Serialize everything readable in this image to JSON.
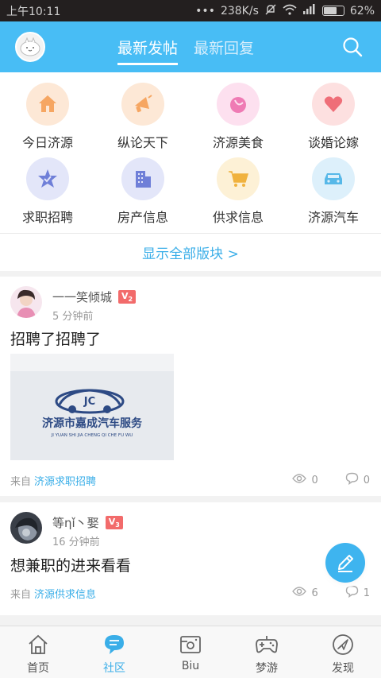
{
  "status_bar": {
    "time": "上午10:11",
    "speed": "238K/s",
    "battery": "62%"
  },
  "header": {
    "tabs": [
      {
        "label": "最新发帖",
        "active": true
      },
      {
        "label": "最新回复",
        "active": false
      }
    ],
    "accent": "#48bdf5"
  },
  "categories": [
    {
      "label": "今日济源",
      "icon": "house-icon",
      "bg": "#fde8d6",
      "color": "#f6a662"
    },
    {
      "label": "纵论天下",
      "icon": "megaphone-icon",
      "bg": "#fde8d6",
      "color": "#f6a662"
    },
    {
      "label": "济源美食",
      "icon": "food-icon",
      "bg": "#fde0ef",
      "color": "#ef7bb4"
    },
    {
      "label": "谈婚论嫁",
      "icon": "heart-icon",
      "bg": "#fde0e0",
      "color": "#ef6e78"
    },
    {
      "label": "求职招聘",
      "icon": "star-badge-icon",
      "bg": "#e3e6f9",
      "color": "#6f7fd8"
    },
    {
      "label": "房产信息",
      "icon": "building-icon",
      "bg": "#e3e6f9",
      "color": "#6f7fd8"
    },
    {
      "label": "供求信息",
      "icon": "cart-icon",
      "bg": "#fdf1d6",
      "color": "#f0b23e"
    },
    {
      "label": "济源汽车",
      "icon": "car-icon",
      "bg": "#ddf0fb",
      "color": "#57b8e8"
    }
  ],
  "show_all_label": "显示全部版块 >",
  "posts": [
    {
      "author": "一一笑倾城",
      "level": "V",
      "level_num": "2",
      "time": "5 分钟前",
      "title": "招聘了招聘了",
      "image_text": "济源市嘉成汽车服务",
      "image_sub": "JI YUAN SHI JIA CHENG QI CHE FU WU",
      "image_logo": "JC",
      "from_label": "来自",
      "board": "济源求职招聘",
      "views": "0",
      "comments": "0"
    },
    {
      "author": "等ηǐ丶娶",
      "level": "V",
      "level_num": "3",
      "time": "16 分钟前",
      "title": "想兼职的进来看看",
      "from_label": "来自",
      "board": "济源供求信息",
      "views": "6",
      "comments": "1"
    }
  ],
  "bottom_nav": [
    {
      "label": "首页",
      "icon": "home-icon",
      "active": false
    },
    {
      "label": "社区",
      "icon": "chat-bubble-icon",
      "active": true
    },
    {
      "label": "Biu",
      "icon": "biu-icon",
      "active": false
    },
    {
      "label": "梦游",
      "icon": "gamepad-icon",
      "active": false
    },
    {
      "label": "发现",
      "icon": "compass-icon",
      "active": false
    }
  ]
}
